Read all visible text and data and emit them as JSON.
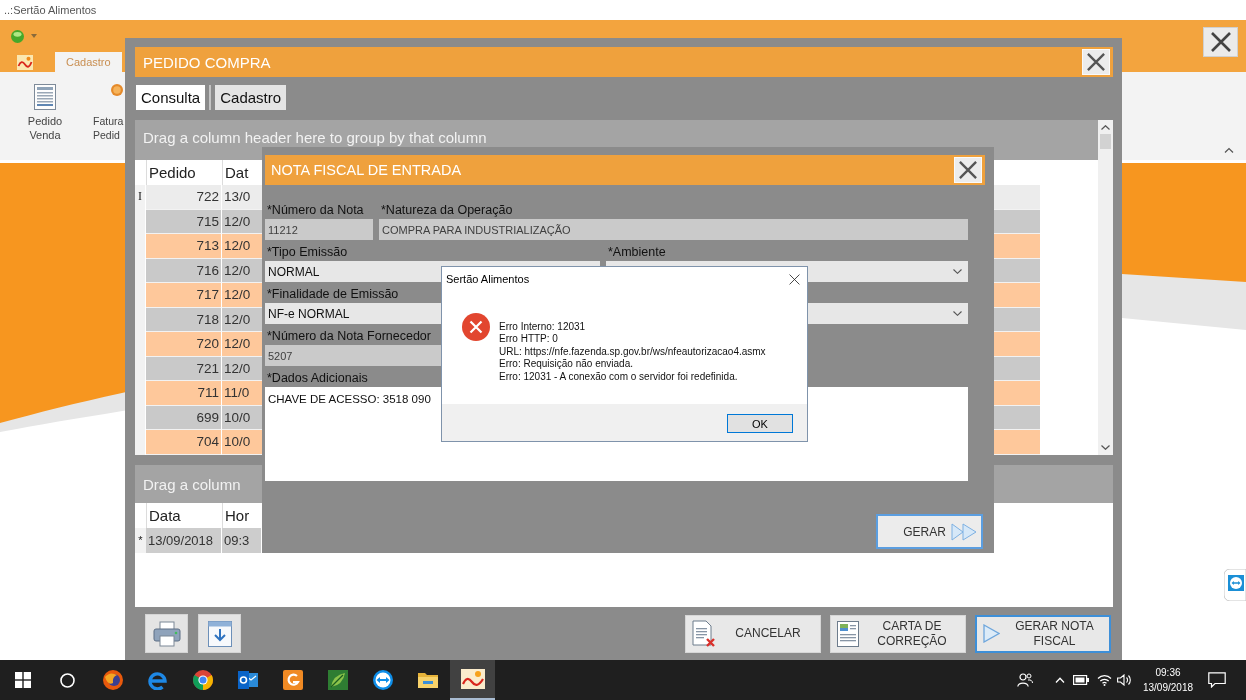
{
  "app_window": {
    "title": "..:Sertão Alimentos",
    "ribbon_tabs": [
      {
        "label": "Cadastro",
        "selected": true
      }
    ],
    "ribbon_buttons": [
      {
        "kind": "document",
        "lines": [
          "Pedido",
          "Venda"
        ]
      },
      {
        "kind": "coin",
        "lines": [
          "Fatura",
          "Pedid"
        ]
      }
    ]
  },
  "order_window": {
    "title": "PEDIDO COMPRA",
    "tabs": [
      {
        "label": "Consulta",
        "selected": true
      },
      {
        "label": "Cadastro",
        "selected": false
      }
    ],
    "orders_grid": {
      "group_hint": "Drag a column header here to group by that column",
      "columns": [
        "Pedido",
        "Dat"
      ],
      "rows": [
        {
          "indicator": "I",
          "selected": true,
          "cells": [
            "722",
            "13/0"
          ]
        },
        {
          "selected": false,
          "cells": [
            "715",
            "12/0"
          ]
        },
        {
          "selected": false,
          "cells": [
            "713",
            "12/0"
          ]
        },
        {
          "selected": false,
          "cells": [
            "716",
            "12/0"
          ]
        },
        {
          "selected": false,
          "cells": [
            "717",
            "12/0"
          ]
        },
        {
          "selected": false,
          "cells": [
            "718",
            "12/0"
          ]
        },
        {
          "selected": false,
          "cells": [
            "720",
            "12/0"
          ]
        },
        {
          "selected": false,
          "cells": [
            "721",
            "12/0"
          ]
        },
        {
          "selected": false,
          "cells": [
            "711",
            "11/0"
          ]
        },
        {
          "selected": false,
          "cells": [
            "699",
            "10/0"
          ]
        },
        {
          "selected": false,
          "cells": [
            "704",
            "10/0"
          ]
        }
      ]
    },
    "history_grid": {
      "group_hint": "Drag a column",
      "columns": [
        "Data",
        "Hor"
      ],
      "rows": [
        {
          "indicator": "*",
          "cells": [
            "13/09/2018",
            "09:3"
          ]
        }
      ]
    },
    "actions": [
      {
        "label": "CANCELAR",
        "kind": "cancel",
        "default": false
      },
      {
        "label": "CARTA DE CORREÇÃO",
        "kind": "letter",
        "default": false
      },
      {
        "label": "GERAR NOTA FISCAL",
        "kind": "generate",
        "default": true
      }
    ]
  },
  "invoice_window": {
    "title": "NOTA FISCAL DE ENTRADA",
    "fields": [
      {
        "label": "*Número da Nota",
        "value": "11212",
        "kind": "readonly"
      },
      {
        "label": "*Natureza da Operação",
        "value": "COMPRA PARA INDUSTRIALIZAÇÃO",
        "kind": "readonly"
      },
      {
        "label": "*Tipo Emissão",
        "value": "NORMAL",
        "kind": "entry"
      },
      {
        "label": "*Ambiente",
        "kind": "select"
      },
      {
        "label": "*Finalidade de Emissão",
        "value": "NF-e NORMAL",
        "kind": "select"
      },
      {
        "label": "*Número da Nota Fornecedor",
        "value": "5207",
        "kind": "readonly"
      },
      {
        "label": "*Dados Adicionais",
        "value": "CHAVE DE ACESSO: 3518 090",
        "kind": "textarea"
      }
    ],
    "generate_button": {
      "label": "GERAR",
      "default": true
    }
  },
  "message_box": {
    "title": "Sertão Alimentos",
    "kind": "error",
    "lines": [
      "Erro Interno: 12031",
      "Erro HTTP: 0",
      "URL: https://nfe.fazenda.sp.gov.br/ws/nfeautorizacao4.asmx",
      "Erro: Requisição não enviada.",
      "Erro: 12031 - A conexão com o servidor foi redefinida."
    ],
    "button": "OK"
  },
  "taskbar": {
    "apps": [
      {
        "kind": "fox",
        "selected": false
      },
      {
        "kind": "swirl",
        "selected": false
      },
      {
        "kind": "segments",
        "selected": false
      },
      {
        "kind": "mail",
        "selected": false
      },
      {
        "kind": "tile",
        "selected": false
      },
      {
        "kind": "leaf",
        "selected": false
      },
      {
        "kind": "remote",
        "selected": false
      },
      {
        "kind": "folder",
        "selected": false
      },
      {
        "kind": "logo",
        "selected": true
      }
    ],
    "clock": {
      "time": "09:36",
      "date": "13/09/2018"
    }
  }
}
